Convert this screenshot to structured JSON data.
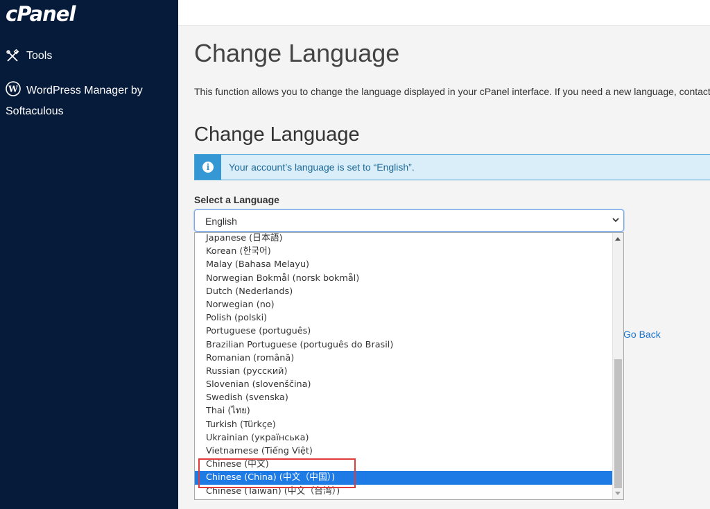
{
  "sidebar": {
    "logo": "cPanel",
    "items": [
      {
        "label": "Tools",
        "icon": "tools-icon"
      },
      {
        "label": "WordPress Manager by Softaculous",
        "icon": "wordpress-icon"
      }
    ]
  },
  "main": {
    "page_title": "Change Language",
    "description": "This function allows you to change the language displayed in your cPanel interface. If you need a new language, contact",
    "section_title": "Change Language",
    "alert": {
      "icon": "info-icon",
      "text": "Your account’s language is set to “English”."
    },
    "select_label": "Select a Language",
    "select_value": "English",
    "go_back": "Go Back"
  },
  "dropdown": {
    "options": [
      "Japanese (日本語)",
      "Korean (한국어)",
      "Malay (Bahasa Melayu)",
      "Norwegian Bokmål (norsk bokmål)",
      "Dutch (Nederlands)",
      "Norwegian (no)",
      "Polish (polski)",
      "Portuguese (português)",
      "Brazilian Portuguese (português do Brasil)",
      "Romanian (română)",
      "Russian (русский)",
      "Slovenian (slovenščina)",
      "Swedish (svenska)",
      "Thai (ไทย)",
      "Turkish (Türkçe)",
      "Ukrainian (українська)",
      "Vietnamese (Tiếng Việt)",
      "Chinese (中文)",
      "Chinese (China) (中文（中国）)",
      "Chinese (Taiwan) (中文（台湾）)"
    ],
    "selected_index": 18
  },
  "colors": {
    "sidebar_bg": "#061a3a",
    "selected_option": "#1e7be6",
    "alert_accent": "#3597d3",
    "highlight": "#e03a3a"
  }
}
